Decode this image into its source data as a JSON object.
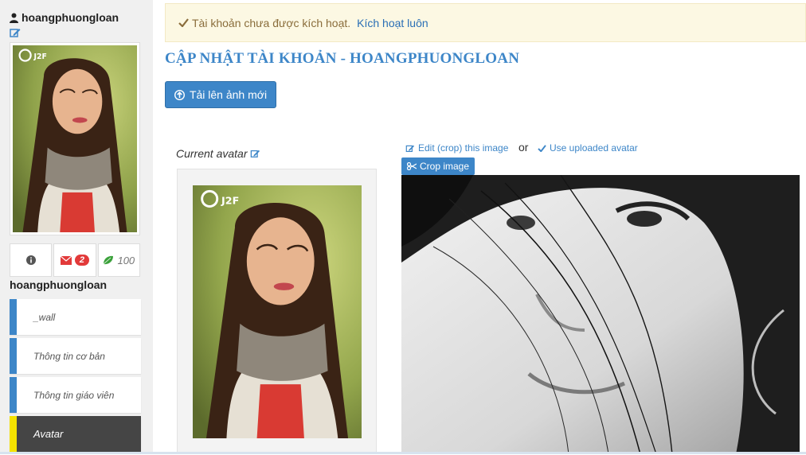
{
  "sidebar": {
    "username": "hoangphuongloan",
    "display_name": "hoangphuongloan",
    "stats": {
      "messages_count": "2",
      "points": "100"
    },
    "menu": [
      {
        "label": "_wall"
      },
      {
        "label": "Thông tin cơ bản"
      },
      {
        "label": "Thông tin giáo viên"
      },
      {
        "label": "Avatar"
      }
    ]
  },
  "alert": {
    "text": "Tài khoản chưa được kích hoạt.",
    "link": "Kích hoạt luôn"
  },
  "main": {
    "title": "CẬP NHẬT TÀI KHOẢN - HOANGPHUONGLOAN",
    "upload_button": "Tải lên ảnh mới",
    "current_avatar_label": "Current avatar",
    "edit_crop_link": "Edit (crop) this image",
    "or_text": "or",
    "use_uploaded_link": "Use uploaded avatar",
    "crop_button": "Crop image"
  },
  "photo_watermark": "J2F",
  "colors": {
    "accent": "#3d86c8",
    "alert_bg": "#fcf8e3",
    "active_item": "#454545",
    "active_marker": "#f5e300",
    "badge": "#e23a3a"
  }
}
